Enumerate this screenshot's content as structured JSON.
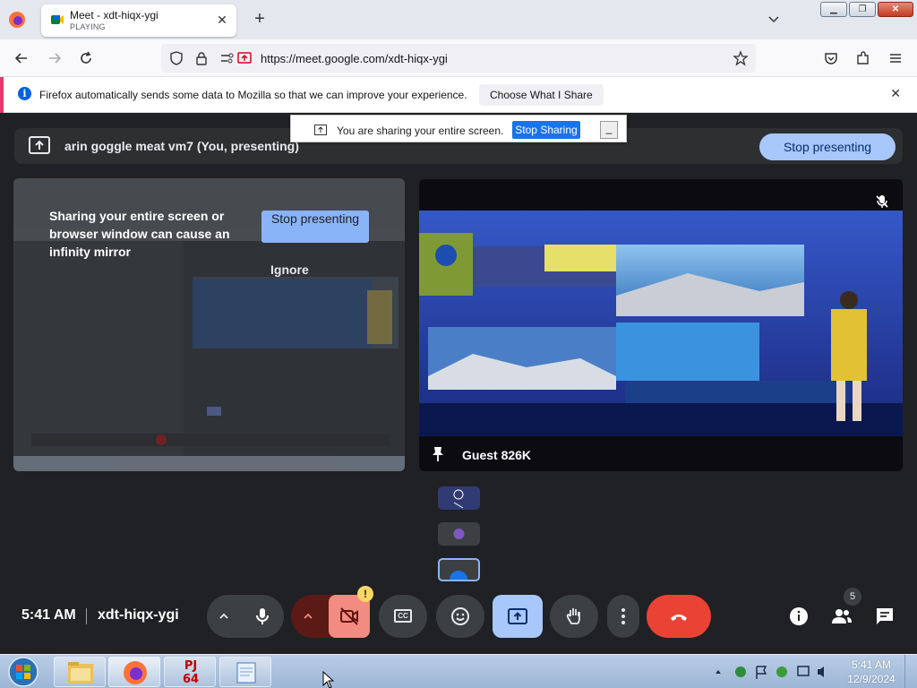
{
  "browser": {
    "tab_title": "Meet - xdt-hiqx-ygi",
    "tab_status": "PLAYING",
    "url": "https://meet.google.com/xdt-hiqx-ygi",
    "notification": "Firefox automatically sends some data to Mozilla so that we can improve your experience.",
    "notification_button": "Choose What I Share"
  },
  "sharing_bar": {
    "text": "You are sharing your entire screen.",
    "stop_label": "Stop Sharing",
    "minimize_label": "_"
  },
  "meet": {
    "presenting_title": "arin goggle meat vm7 (You, presenting)",
    "stop_presenting_label": "Stop presenting",
    "infinity_warning": "Sharing your entire screen or browser window can cause an infinity mirror",
    "warning_stop_label": "Stop presenting",
    "ignore_label": "Ignore",
    "guest_name": "Guest 826K",
    "time": "5:41 AM",
    "meeting_code": "xdt-hiqx-ygi",
    "participant_count": "5",
    "camera_alert": "!",
    "captions_label": "CC"
  },
  "taskbar": {
    "time": "5:41 AM",
    "date": "12/9/2024",
    "app_label": "PJ 64"
  },
  "colors": {
    "meet_bg": "#202124",
    "accent": "#a8c7fa",
    "end_call": "#ea4335",
    "sharebar_button": "#1a73e8"
  }
}
